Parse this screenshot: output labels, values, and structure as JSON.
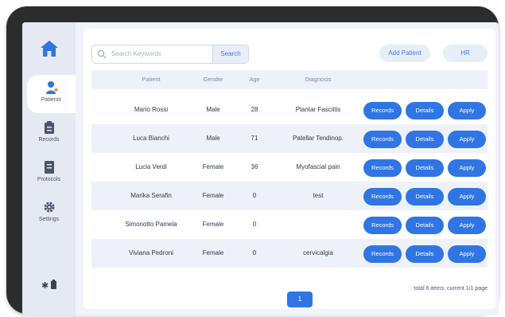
{
  "search": {
    "placeholder": "Search Keywords",
    "button": "Search"
  },
  "toolbar": {
    "add_patient": "Add Patient",
    "hr": "HR"
  },
  "nav": [
    {
      "label": "Patients",
      "icon": "patient-icon"
    },
    {
      "label": "Records",
      "icon": "records-icon"
    },
    {
      "label": "Protocols",
      "icon": "protocols-icon"
    },
    {
      "label": "Settings",
      "icon": "gear-icon"
    }
  ],
  "table": {
    "headers": [
      "Patient",
      "Gender",
      "Age",
      "Diagnosis"
    ],
    "rows": [
      {
        "patient": "Mario Rossi",
        "gender": "Male",
        "age": "28",
        "diagnosis": "Plantar Fasciitis"
      },
      {
        "patient": "Luca Bianchi",
        "gender": "Male",
        "age": "71",
        "diagnosis": "Patellar Tendinop."
      },
      {
        "patient": "Lucia Verdi",
        "gender": "Female",
        "age": "36",
        "diagnosis": "Myofascial pain"
      },
      {
        "patient": "Marika Serafin",
        "gender": "Female",
        "age": "0",
        "diagnosis": "test"
      },
      {
        "patient": "Simonotto Pamela",
        "gender": "Female",
        "age": "0",
        "diagnosis": ""
      },
      {
        "patient": "Viviana Pedroni",
        "gender": "Female",
        "age": "0",
        "diagnosis": "cervicalgia"
      }
    ],
    "actions": [
      "Records",
      "Details",
      "Apply"
    ]
  },
  "footer": {
    "summary": "total 6 items, current 1/1 page"
  },
  "pagination": {
    "current_page": "1"
  },
  "status": {
    "bluetooth_icon": "bluetooth-icon",
    "battery_icon": "battery-icon"
  },
  "colors": {
    "accent": "#2f75e4",
    "sidebar": "#e4e9f2",
    "row_alt": "#eef2f8"
  }
}
